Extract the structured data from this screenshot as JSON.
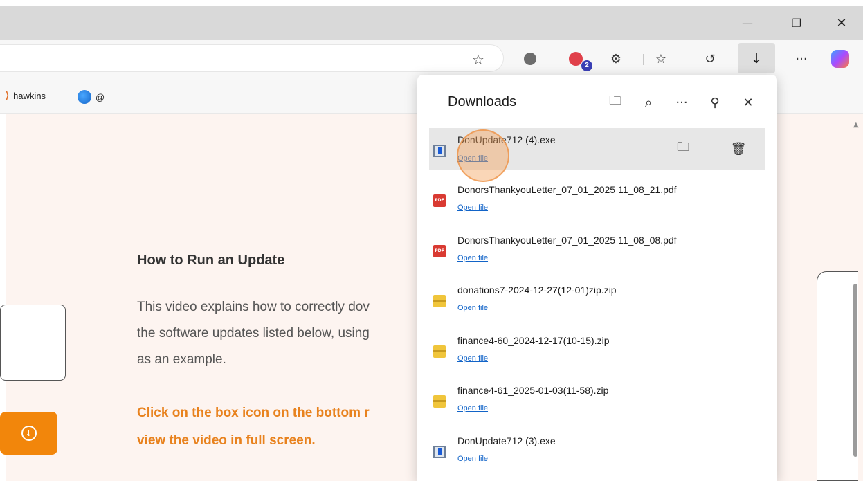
{
  "window": {
    "minimize_icon": "minimize-icon",
    "maximize_icon": "restore-icon",
    "close_icon": "close-icon"
  },
  "toolbar": {
    "extension_badge": "2",
    "download_icon": "download-icon"
  },
  "bookmarks": [
    {
      "label": "hawkins",
      "icon": "bookmark-favicon"
    },
    {
      "label": "@",
      "icon": "edge-favicon"
    }
  ],
  "page": {
    "heading": "How to Run an Update",
    "paragraph_lines": [
      "This video explains how to correctly dov",
      "the software updates listed below, using",
      "as an example."
    ],
    "orange_lines": [
      "Click on the box icon on the bottom r",
      "view the video in full screen."
    ]
  },
  "downloads": {
    "title": "Downloads",
    "items": [
      {
        "name": "DonUpdate712 (4).exe",
        "type": "exe",
        "action": "Open file"
      },
      {
        "name": "DonorsThankyouLetter_07_01_2025 11_08_21.pdf",
        "type": "pdf",
        "action": "Open file"
      },
      {
        "name": "DonorsThankyouLetter_07_01_2025 11_08_08.pdf",
        "type": "pdf",
        "action": "Open file"
      },
      {
        "name": "donations7-2024-12-27(12-01)zip.zip",
        "type": "zip",
        "action": "Open file"
      },
      {
        "name": "finance4-60_2024-12-17(10-15).zip",
        "type": "zip",
        "action": "Open file"
      },
      {
        "name": "finance4-61_2025-01-03(11-58).zip",
        "type": "zip",
        "action": "Open file"
      },
      {
        "name": "DonUpdate712 (3).exe",
        "type": "exe",
        "action": "Open file"
      }
    ]
  },
  "colors": {
    "accent_orange": "#e8821e",
    "link_blue": "#1264c8",
    "highlight": "#f4a460"
  }
}
